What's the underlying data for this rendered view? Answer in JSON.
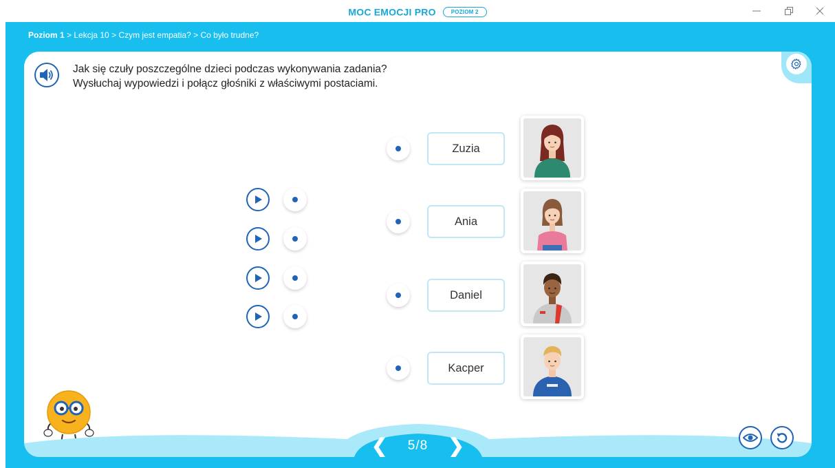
{
  "window": {
    "title": "MOC EMOCJI PRO",
    "level_badge": "POZIOM 2",
    "controls": {
      "minimize": "—",
      "maximize": "🗗",
      "close": "✕"
    }
  },
  "breadcrumb": {
    "first": "Poziom 1",
    "rest": " > Lekcja 10 > Czym jest empatia? > Co było trudne?"
  },
  "instructions": {
    "line1": "Jak się czuły poszczególne dzieci podczas wykonywania zadania?",
    "line2": "Wysłuchaj wypowiedzi i połącz głośniki z właściwymi postaciami."
  },
  "icons": {
    "speaker": "speaker-icon",
    "settings": "gear-icon",
    "play": "play-icon",
    "eye": "eye-icon",
    "reset": "reset-icon"
  },
  "characters": [
    {
      "name": "Zuzia"
    },
    {
      "name": "Ania"
    },
    {
      "name": "Daniel"
    },
    {
      "name": "Kacper"
    }
  ],
  "pager": {
    "prev": "❮",
    "current": "5",
    "separator": "/",
    "total": "8",
    "next": "❯"
  },
  "colors": {
    "frame": "#18bfee",
    "accent": "#1f64b6",
    "title": "#17a8d8"
  }
}
